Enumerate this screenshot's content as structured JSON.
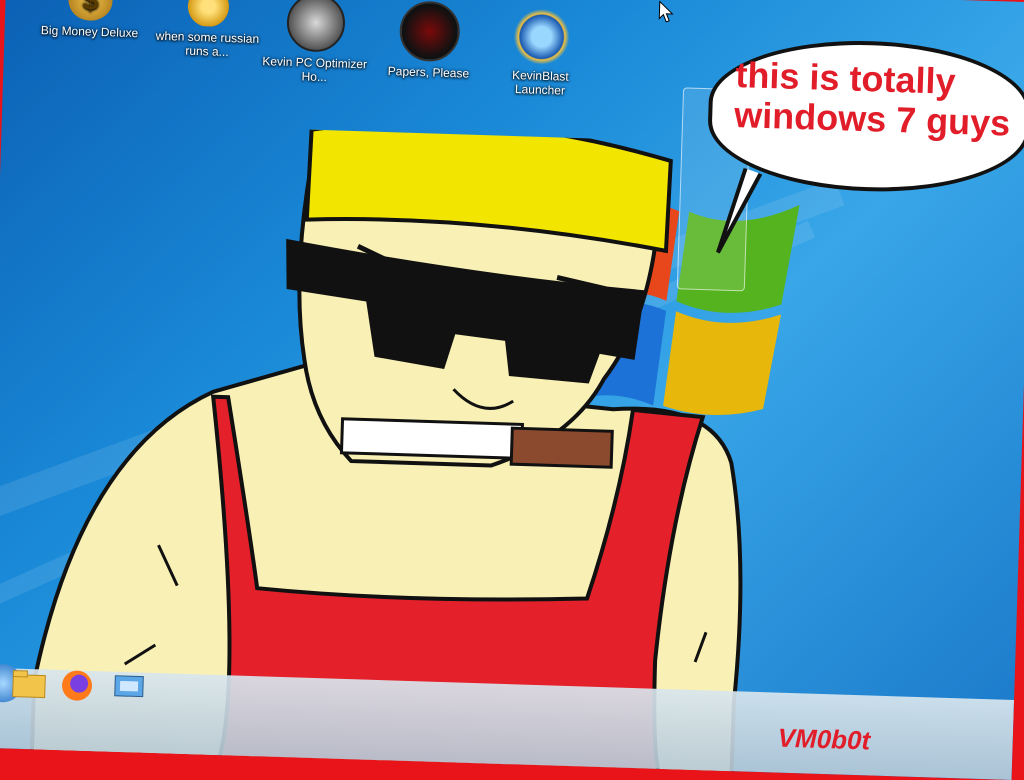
{
  "desktop": {
    "icons": [
      {
        "label": "Big Money Deluxe",
        "icon": "dollar-coin-icon"
      },
      {
        "label": "when some russian runs a...",
        "icon": "gear-icon"
      },
      {
        "label": "Kevin PC Optimizer Ho...",
        "icon": "gauge-icon"
      },
      {
        "label": "Papers, Please",
        "icon": "red-seal-icon"
      },
      {
        "label": "KevinBlast Launcher",
        "icon": "globe-star-icon"
      }
    ]
  },
  "speech_bubble": {
    "text": "this is totally windows 7 guys"
  },
  "taskbar": {
    "pinned": [
      {
        "icon": "folder-icon"
      },
      {
        "icon": "firefox-icon"
      },
      {
        "icon": "control-panel-icon"
      }
    ]
  },
  "watermark": {
    "text": "VM0b0t"
  },
  "colors": {
    "bubble_text": "#e11d2a",
    "frame": "#e8141a",
    "desktop": "#1a8ad8"
  }
}
